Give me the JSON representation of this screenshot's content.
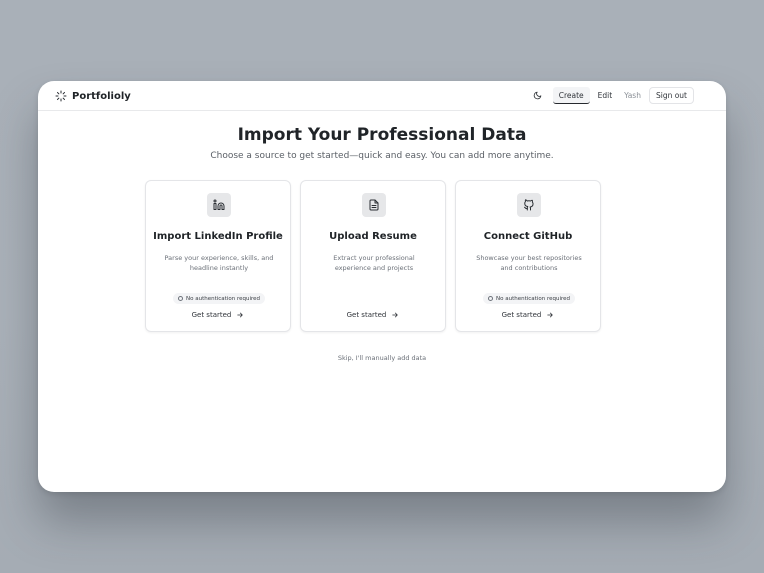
{
  "app": {
    "name": "Portfolioly"
  },
  "nav": {
    "create": "Create",
    "edit": "Edit",
    "user": "Yash",
    "sign_out": "Sign out"
  },
  "page": {
    "title": "Import Your Professional Data",
    "subtitle": "Choose a source to get started—quick and easy. You can add more anytime.",
    "skip": "Skip, I'll manually add data"
  },
  "cards": [
    {
      "icon": "linkedin-icon",
      "title": "Import LinkedIn Profile",
      "description": "Parse your experience, skills, and headline instantly",
      "badge": "No authentication required",
      "cta": "Get started"
    },
    {
      "icon": "file-icon",
      "title": "Upload Resume",
      "description": "Extract your professional experience and projects",
      "badge": "",
      "cta": "Get started"
    },
    {
      "icon": "github-icon",
      "title": "Connect GitHub",
      "description": "Showcase your best repositories and contributions",
      "badge": "No authentication required",
      "cta": "Get started"
    }
  ],
  "colors": {
    "background": "#aab1b9",
    "surface": "#ffffff",
    "text": "#1f2327",
    "muted": "#6b7078",
    "icon_bg": "#e6e7e9"
  }
}
